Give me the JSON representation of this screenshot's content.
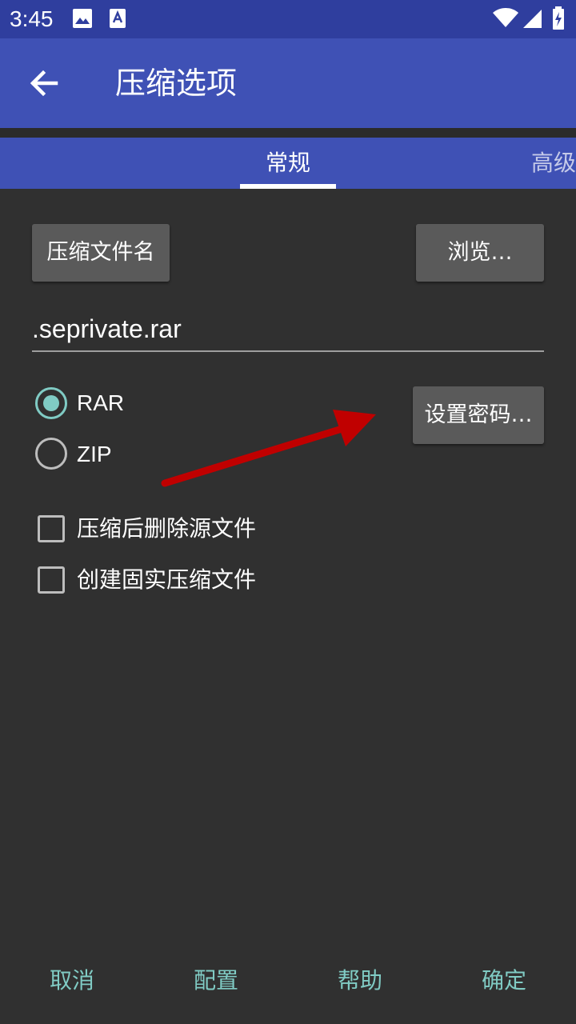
{
  "status_bar": {
    "time": "3:45"
  },
  "app_bar": {
    "title": "压缩选项"
  },
  "tabs": [
    {
      "label": "常规",
      "selected": true
    },
    {
      "label": "高级",
      "selected": false
    }
  ],
  "general": {
    "archive_name_button": "压缩文件名",
    "browse_button": "浏览…",
    "archive_name_value": ".seprivate.rar",
    "format_options": [
      {
        "label": "RAR",
        "checked": true
      },
      {
        "label": "ZIP",
        "checked": false
      }
    ],
    "set_password_button": "设置密码…",
    "checkboxes": [
      {
        "label": "压缩后删除源文件",
        "checked": false
      },
      {
        "label": "创建固实压缩文件",
        "checked": false
      }
    ]
  },
  "bottom_bar": {
    "cancel": "取消",
    "config": "配置",
    "help": "帮助",
    "ok": "确定"
  },
  "colors": {
    "status_bar": "#2f3e9e",
    "app_bar": "#3f51b5",
    "accent": "#80cbc4",
    "background": "#303030",
    "annotation_arrow": "#c00000"
  }
}
